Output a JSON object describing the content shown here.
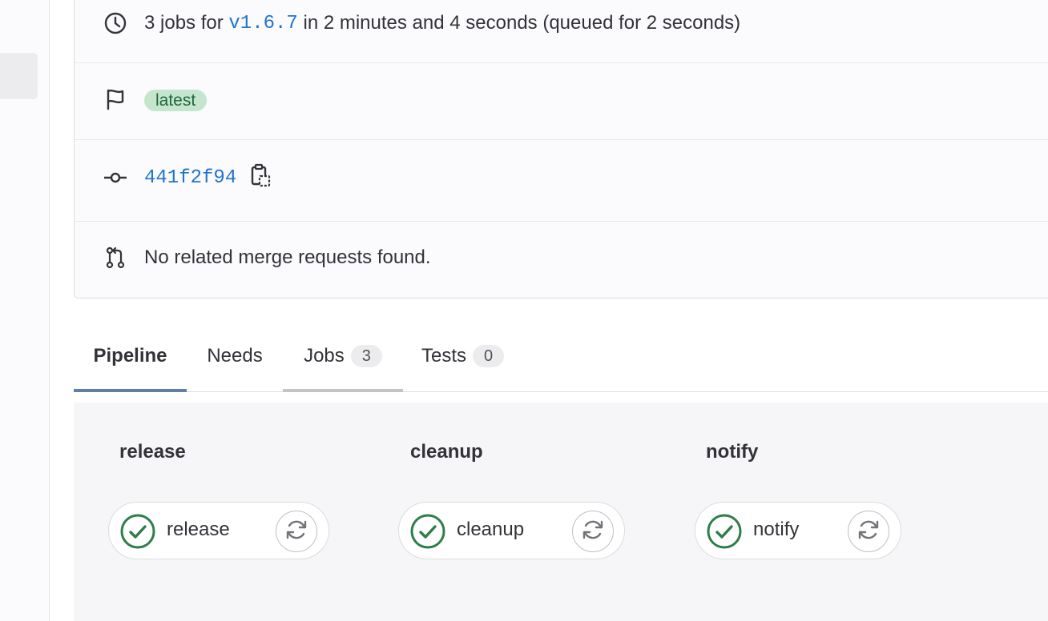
{
  "summary": {
    "jobs_prefix": "3 jobs for",
    "ref": "v1.6.7",
    "duration_text": "in 2 minutes and 4 seconds (queued for 2 seconds)"
  },
  "badge": {
    "label": "latest"
  },
  "commit": {
    "sha": "441f2f94"
  },
  "merge_requests": {
    "text": "No related merge requests found."
  },
  "tabs": [
    {
      "label": "Pipeline",
      "count": ""
    },
    {
      "label": "Needs",
      "count": ""
    },
    {
      "label": "Jobs",
      "count": "3"
    },
    {
      "label": "Tests",
      "count": "0"
    }
  ],
  "stages": [
    {
      "title": "release",
      "job": "release",
      "status": "success"
    },
    {
      "title": "cleanup",
      "job": "cleanup",
      "status": "success"
    },
    {
      "title": "notify",
      "job": "notify",
      "status": "success"
    }
  ],
  "colors": {
    "accent": "#1f75cb",
    "success": "#2f7d4a",
    "tab_active": "#5f7ea8",
    "tab_hover": "#c4c4c7"
  },
  "icons": {
    "duration": "clock-icon",
    "tag": "flag-icon",
    "commit": "commit-icon",
    "merge_request": "merge-request-icon",
    "copy": "copy-to-clipboard-icon",
    "status": "status-success-icon",
    "retry": "retry-icon"
  }
}
